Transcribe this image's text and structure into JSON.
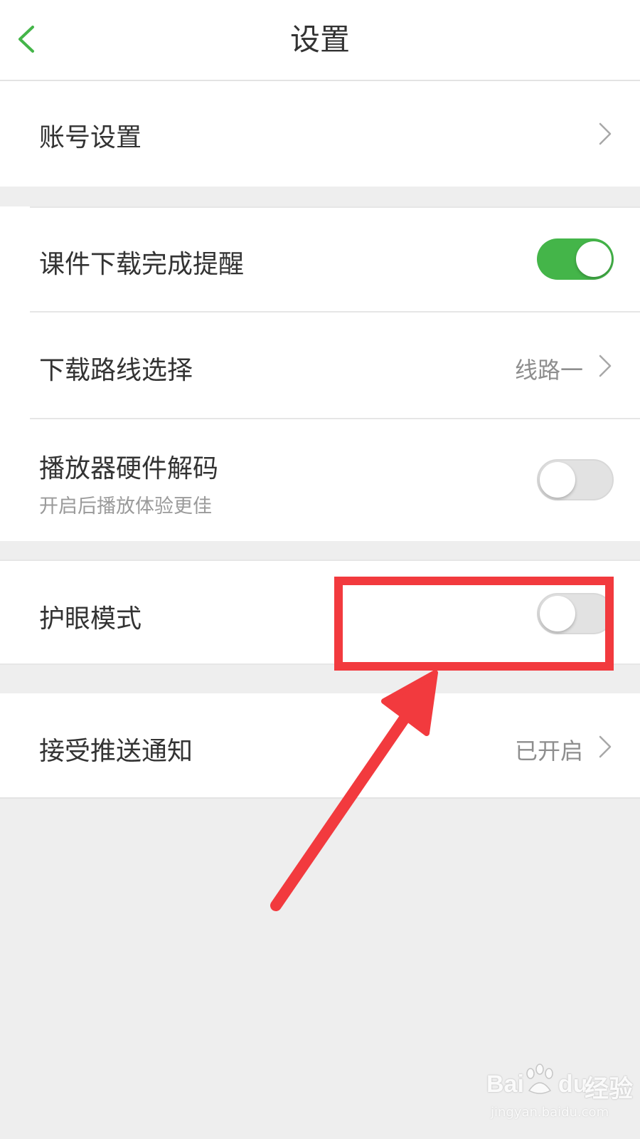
{
  "navbar": {
    "title": "设置"
  },
  "group_account": {
    "account_settings_label": "账号设置"
  },
  "group_download": {
    "download_reminder_label": "课件下载完成提醒",
    "download_reminder_on": true,
    "download_route_label": "下载路线选择",
    "download_route_value": "线路一",
    "hardware_decode_label": "播放器硬件解码",
    "hardware_decode_sub": "开启后播放体验更佳",
    "hardware_decode_on": false
  },
  "group_eye": {
    "eye_protection_label": "护眼模式",
    "eye_protection_on": false
  },
  "group_push": {
    "push_label": "接受推送通知",
    "push_value": "已开启"
  },
  "colors": {
    "accent_green": "#44b549",
    "annotation_red": "#f23a3e"
  },
  "watermark": {
    "brand": "Bai",
    "brand_suffix": "du",
    "product": "经验",
    "url": "jingyan.baidu.com"
  }
}
